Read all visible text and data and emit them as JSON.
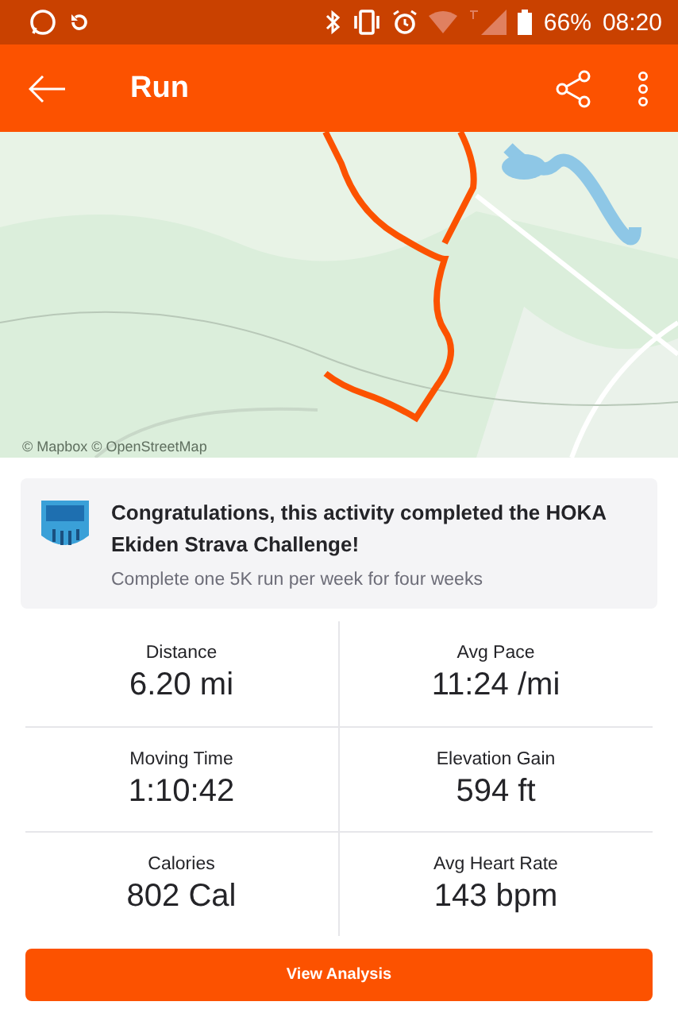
{
  "status_bar": {
    "battery": "66%",
    "time": "08:20"
  },
  "app_bar": {
    "title": "Run"
  },
  "map": {
    "attribution": "© Mapbox © OpenStreetMap"
  },
  "challenge": {
    "title": "Congratulations, this activity completed the HOKA Ekiden Strava Challenge!",
    "description": "Complete one 5K run per week for four weeks"
  },
  "stats": [
    {
      "label": "Distance",
      "value": "6.20 mi"
    },
    {
      "label": "Avg Pace",
      "value": "11:24 /mi"
    },
    {
      "label": "Moving Time",
      "value": "1:10:42"
    },
    {
      "label": "Elevation Gain",
      "value": "594 ft"
    },
    {
      "label": "Calories",
      "value": "802 Cal"
    },
    {
      "label": "Avg Heart Rate",
      "value": "143 bpm"
    }
  ],
  "buttons": [
    "View Analysis"
  ]
}
